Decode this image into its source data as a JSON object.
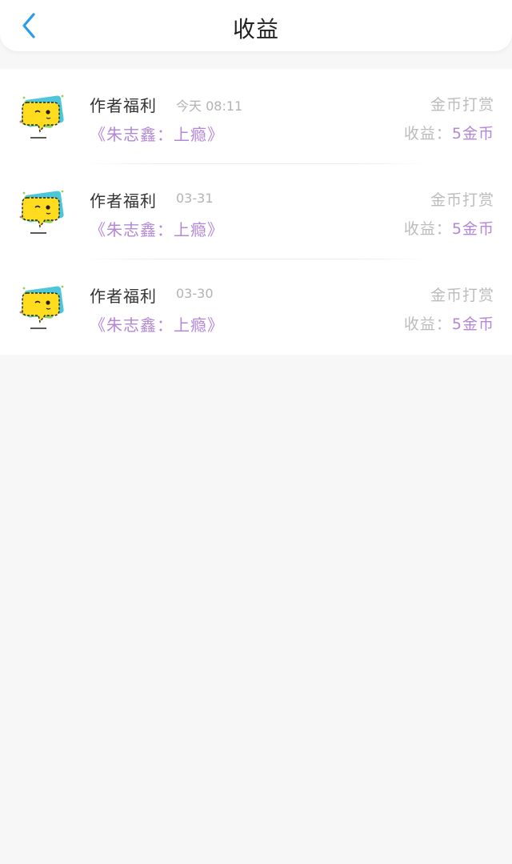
{
  "header": {
    "title": "收益",
    "back_icon": "chevron-left-icon",
    "accent": "#2a9ce8"
  },
  "earnings": [
    {
      "name": "作者福利",
      "time": "今天 08:11",
      "book": "《朱志鑫：上瘾》",
      "type": "金币打赏",
      "earning_label": "收益：",
      "earning_amount": "5金币",
      "avatar_icon": "yellow-chat-bubble-icon"
    },
    {
      "name": "作者福利",
      "time": "03-31",
      "book": "《朱志鑫：上瘾》",
      "type": "金币打赏",
      "earning_label": "收益：",
      "earning_amount": "5金币",
      "avatar_icon": "yellow-chat-bubble-icon"
    },
    {
      "name": "作者福利",
      "time": "03-30",
      "book": "《朱志鑫：上瘾》",
      "type": "金币打赏",
      "earning_label": "收益：",
      "earning_amount": "5金币",
      "avatar_icon": "yellow-chat-bubble-icon"
    }
  ],
  "colors": {
    "purple_text": "#b487d8",
    "gray_text": "#bcbcbc",
    "background": "#f8f7f8"
  }
}
